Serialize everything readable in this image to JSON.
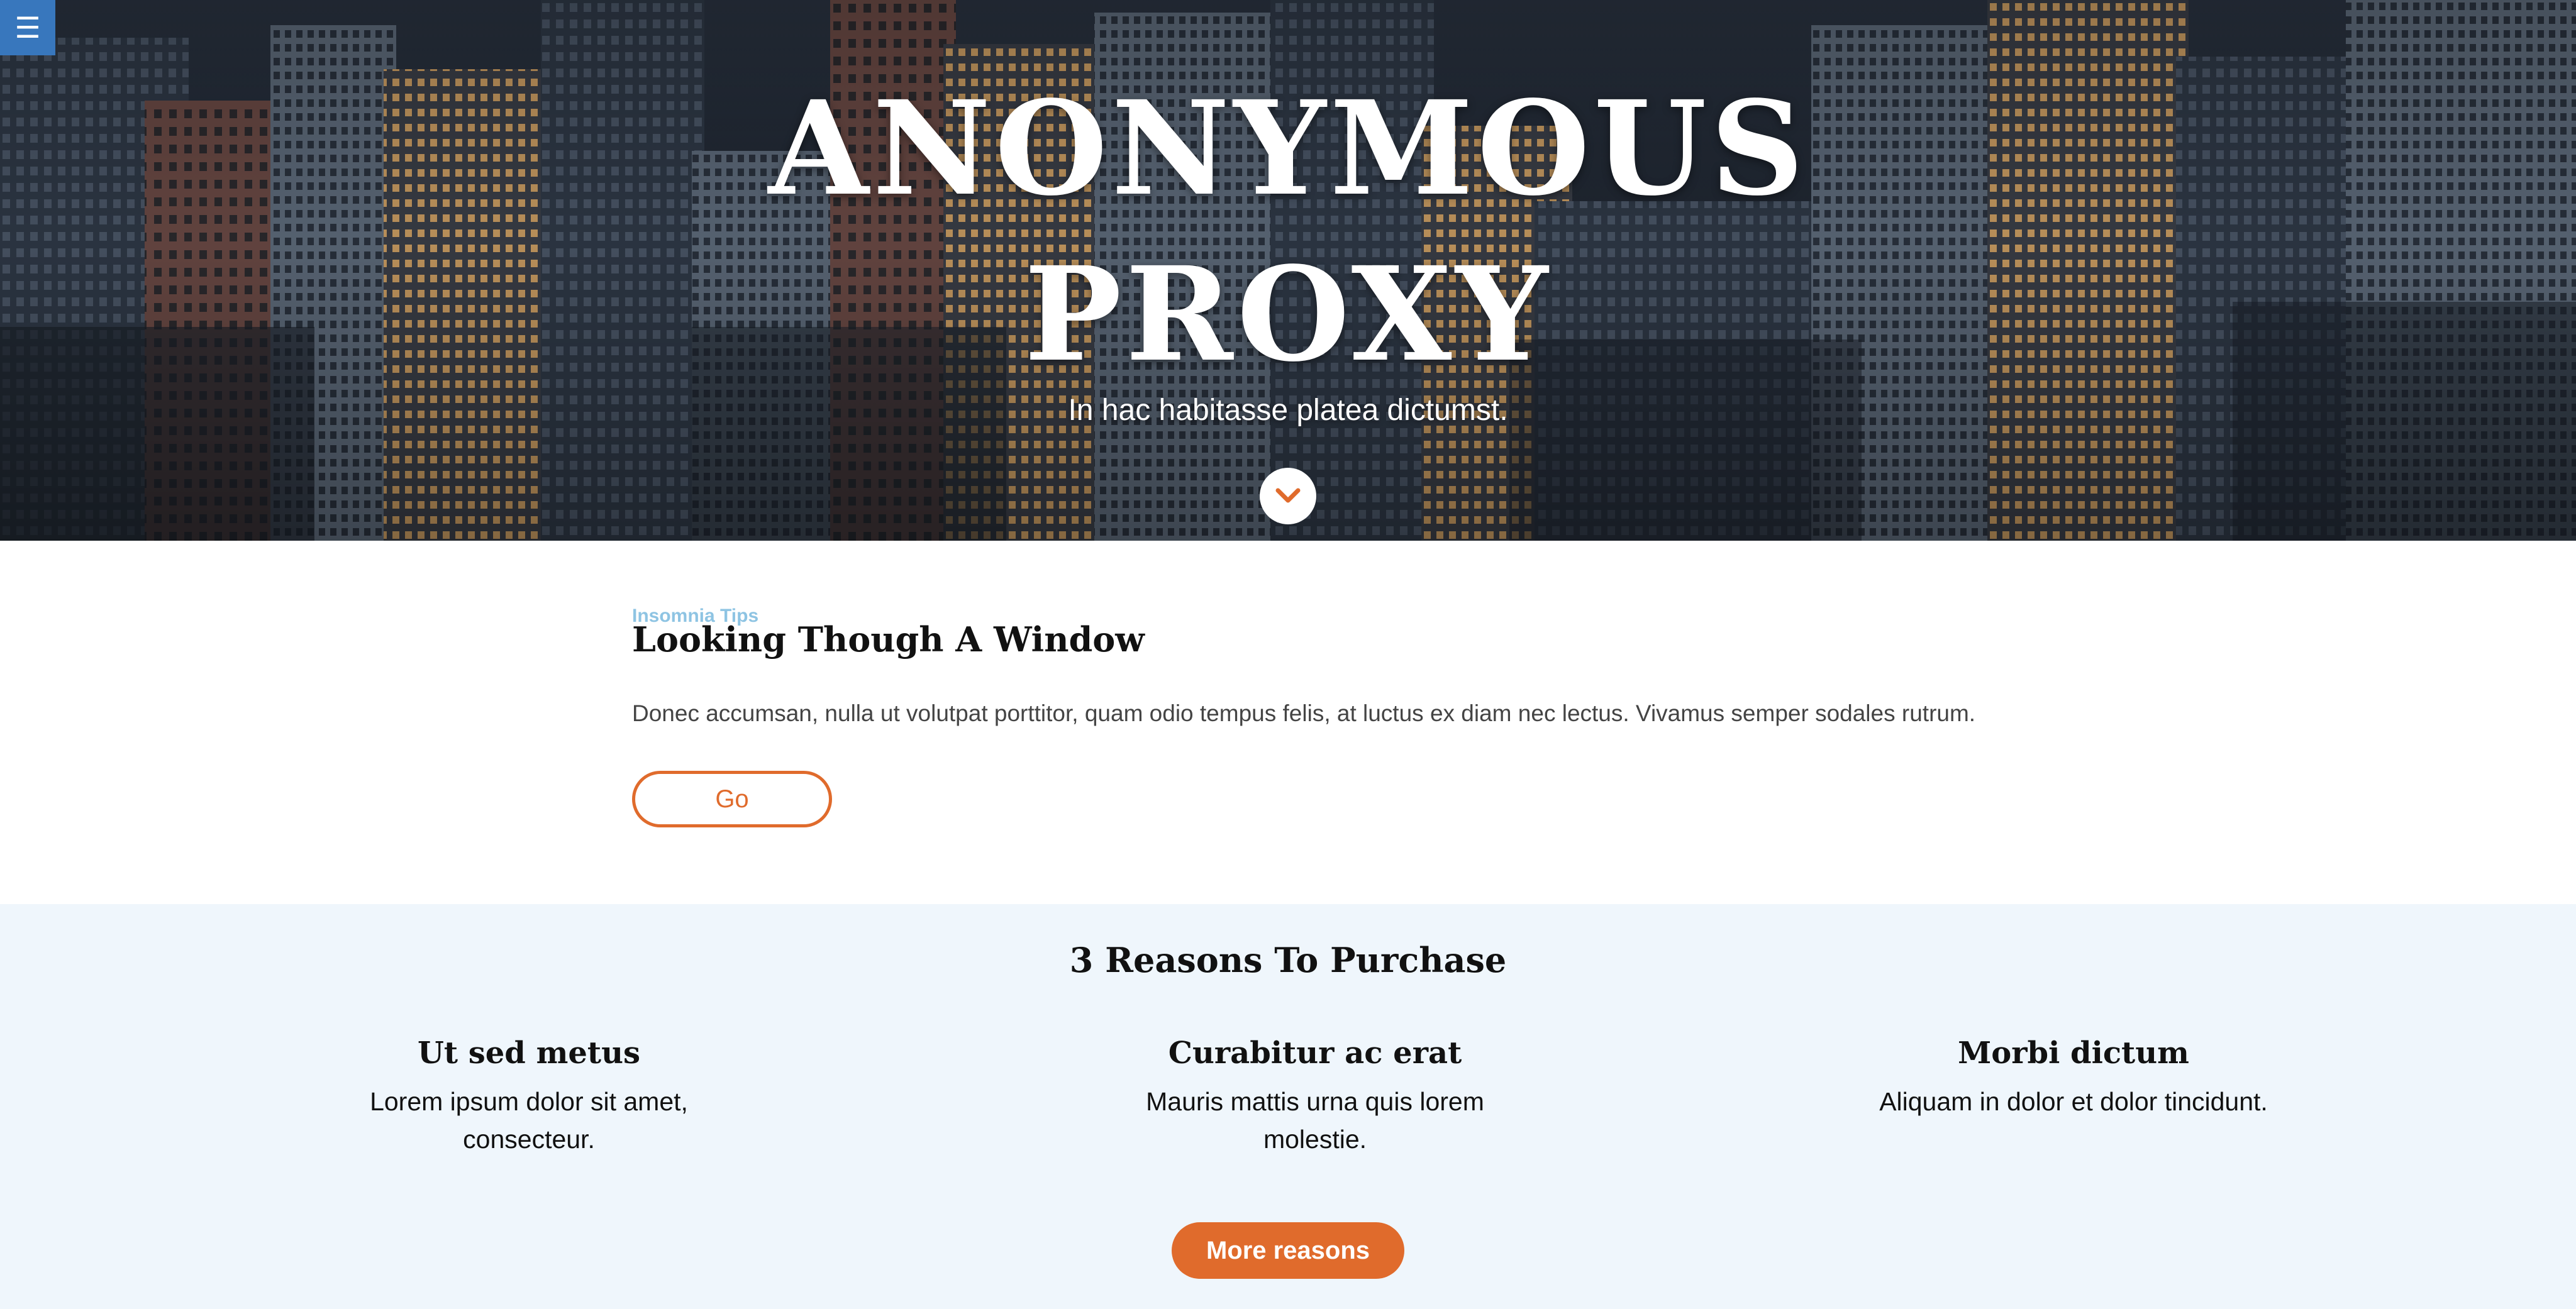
{
  "nav": {
    "menu_icon": "hamburger-menu-icon",
    "menu_glyph": "☰",
    "accent_color": "#3877bd"
  },
  "hero": {
    "title_line1": "ANONYMOUS",
    "title_line2": "PROXY",
    "subtitle": "In hac habitasse platea dictumst.",
    "scroll_icon": "chevron-down-icon"
  },
  "article": {
    "eyebrow": "Insomnia Tips",
    "title": "Looking Though A Window",
    "text": "Donec accumsan, nulla ut volutpat porttitor, quam odio tempus felis, at luctus ex diam nec lectus. Vivamus semper sodales rutrum.",
    "button_label": "Go"
  },
  "reasons": {
    "title": "3 Reasons To Purchase",
    "items": [
      {
        "heading": "Ut sed metus",
        "text": "Lorem ipsum dolor sit amet, consecteur."
      },
      {
        "heading": "Curabitur ac erat",
        "text": "Mauris mattis urna quis lorem molestie."
      },
      {
        "heading": "Morbi dictum",
        "text": "Aliquam in dolor et dolor tincidunt."
      }
    ],
    "button_label": "More reasons"
  },
  "colors": {
    "brand_orange": "#e06b2c",
    "menu_blue": "#3877bd",
    "eyebrow_blue": "#8ec4e3",
    "reasons_bg": "#eff6fc"
  }
}
